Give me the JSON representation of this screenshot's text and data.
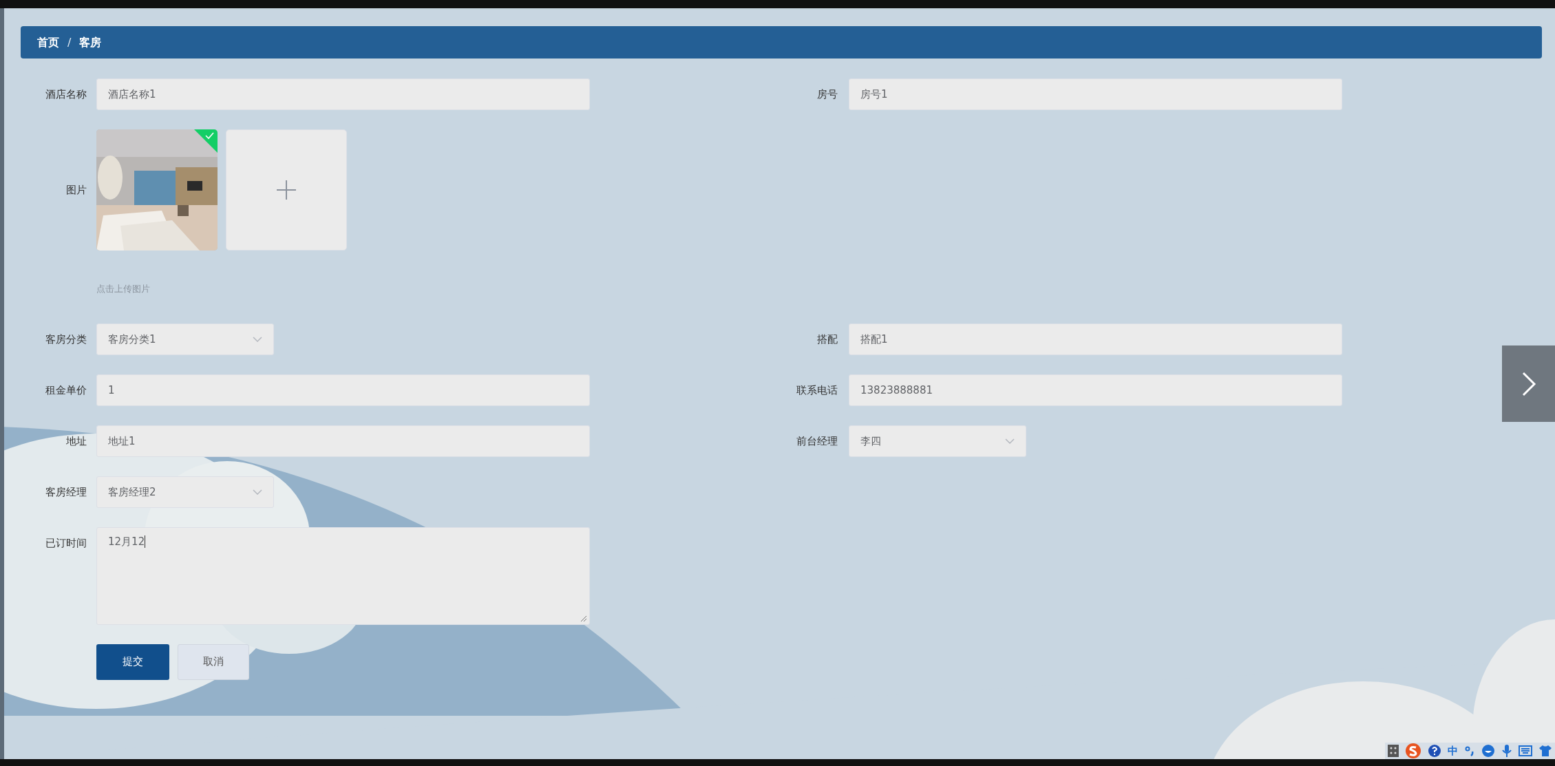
{
  "breadcrumb": {
    "separator": "/",
    "items": [
      {
        "label": "首页"
      },
      {
        "label": "客房"
      }
    ]
  },
  "form": {
    "rows": [
      {
        "fields": [
          {
            "kind": "text",
            "label": "酒店名称",
            "value": "酒店名称1"
          },
          {
            "kind": "text",
            "label": "房号",
            "value": "房号1"
          }
        ]
      },
      {
        "fields": [
          {
            "kind": "upload",
            "label": "图片",
            "images": [
              {
                "kind": "picture",
                "uploaded": true
              }
            ],
            "hint": "点击上传图片"
          }
        ]
      },
      {
        "fields": [
          {
            "kind": "select",
            "label": "客房分类",
            "value": "客房分类1"
          },
          {
            "kind": "text",
            "label": "搭配",
            "value": "搭配1"
          }
        ]
      },
      {
        "fields": [
          {
            "kind": "text",
            "label": "租金单价",
            "value": "1"
          },
          {
            "kind": "text",
            "label": "联系电话",
            "value": "13823888881"
          }
        ]
      },
      {
        "fields": [
          {
            "kind": "text",
            "label": "地址",
            "value": "地址1"
          },
          {
            "kind": "select",
            "label": "前台经理",
            "value": "李四"
          }
        ]
      },
      {
        "fields": [
          {
            "kind": "select",
            "label": "客房经理",
            "value": "客房经理2"
          }
        ]
      },
      {
        "fields": [
          {
            "kind": "textarea",
            "label": "已订时间",
            "value": "12月12"
          }
        ]
      }
    ],
    "buttons": [
      {
        "kind": "primary",
        "label": "提交"
      },
      {
        "kind": "secondary",
        "label": "取消"
      }
    ]
  },
  "ime_toolbar": {
    "mode": "中"
  }
}
